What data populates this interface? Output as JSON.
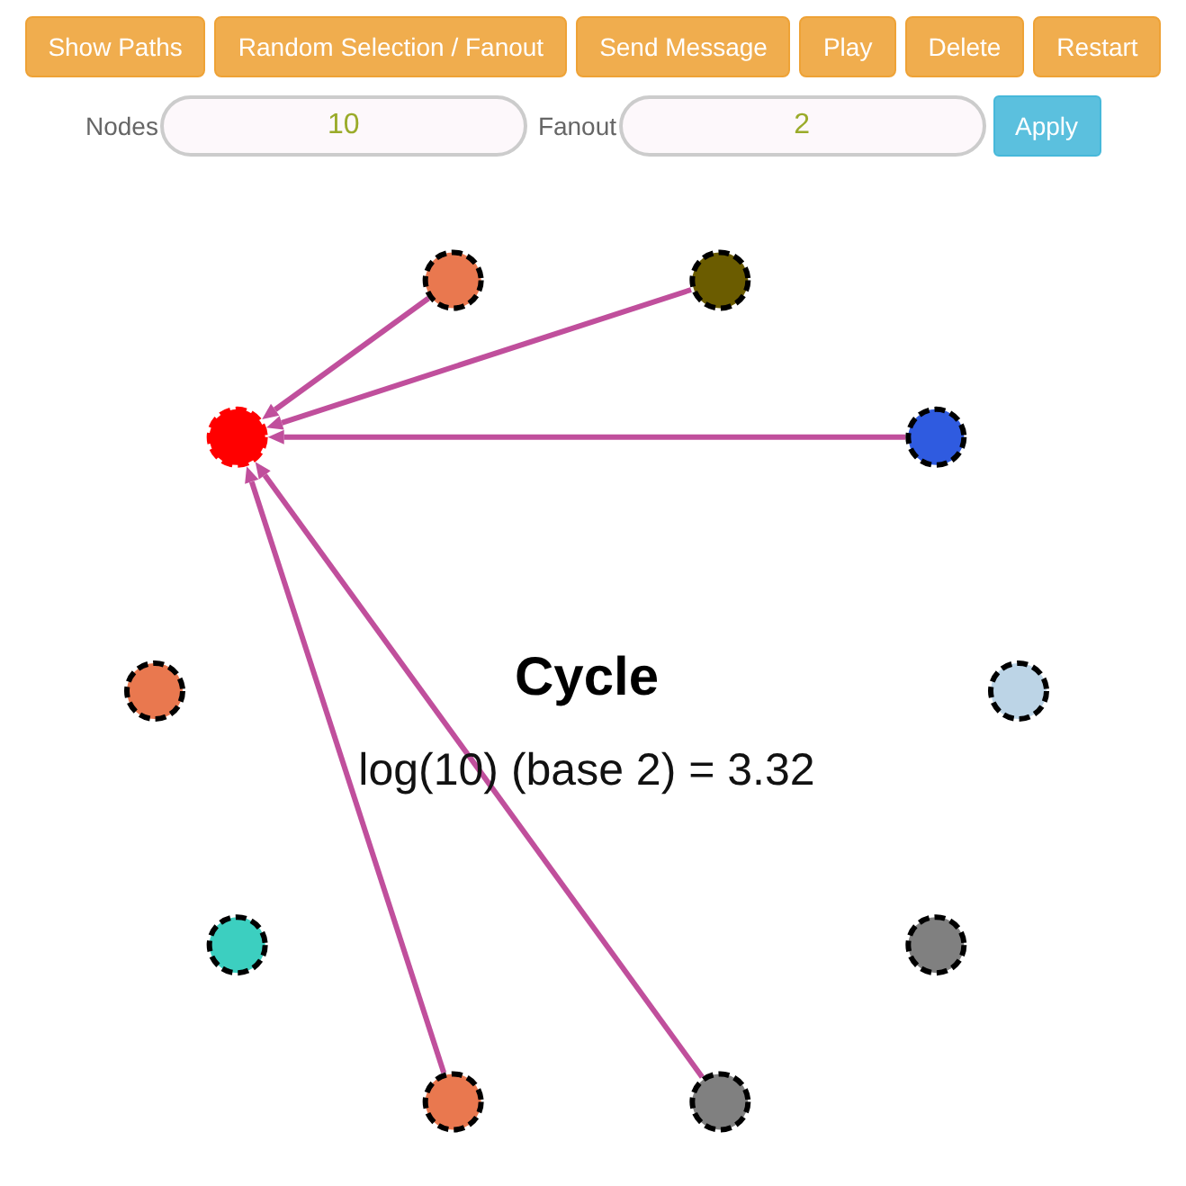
{
  "toolbar": {
    "buttons": [
      "Show Paths",
      "Random Selection / Fanout",
      "Send Message",
      "Play",
      "Delete",
      "Restart"
    ]
  },
  "settings": {
    "fields": [
      {
        "label": "Nodes",
        "value": "10"
      },
      {
        "label": "Fanout",
        "value": "2"
      }
    ],
    "apply_button": "Apply"
  },
  "graph": {
    "title": "Cycle",
    "subtitle": "log(10) (base 2) = 3.32",
    "nodes": [
      {
        "color": "#bcd4e6",
        "selected": false,
        "linked": false
      },
      {
        "color": "#2f5be0",
        "selected": false,
        "linked": true
      },
      {
        "color": "#6b5c00",
        "selected": false,
        "linked": true
      },
      {
        "color": "#e9784f",
        "selected": false,
        "linked": true
      },
      {
        "color": "#ff0000",
        "selected": true,
        "linked": false
      },
      {
        "color": "#e9784f",
        "selected": false,
        "linked": false
      },
      {
        "color": "#3ccfc0",
        "selected": false,
        "linked": false
      },
      {
        "color": "#e9784f",
        "selected": false,
        "linked": true
      },
      {
        "color": "#808080",
        "selected": false,
        "linked": true
      },
      {
        "color": "#808080",
        "selected": false,
        "linked": false
      }
    ]
  }
}
